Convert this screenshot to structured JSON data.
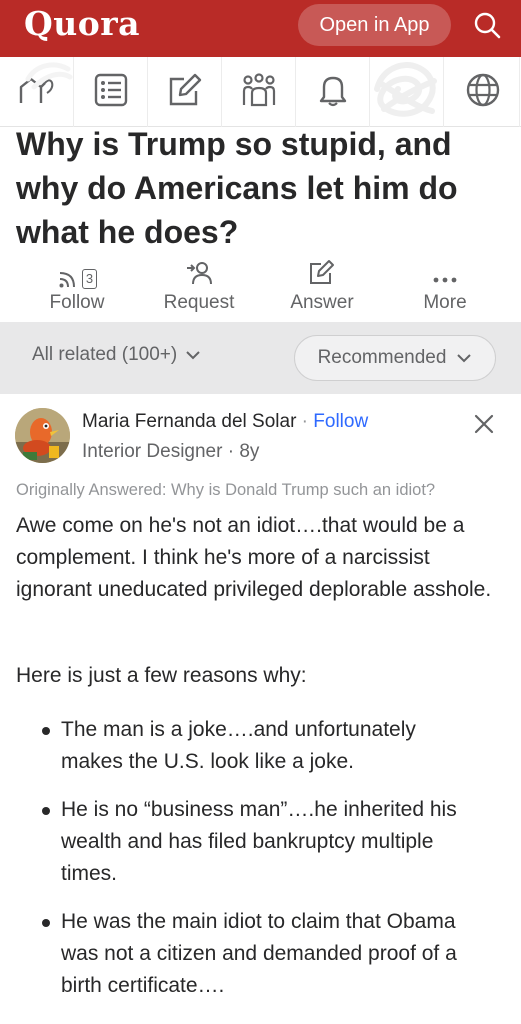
{
  "header": {
    "logo": "Quora",
    "open_app_label": "Open in App",
    "search_icon": "search-icon",
    "background": "#b92b27"
  },
  "nav": {
    "items": [
      {
        "icon": "home-icon"
      },
      {
        "icon": "following-icon"
      },
      {
        "icon": "answer-icon"
      },
      {
        "icon": "spaces-icon"
      },
      {
        "icon": "notifications-icon"
      },
      {
        "icon": "profile-icon"
      },
      {
        "icon": "language-icon"
      }
    ]
  },
  "question": {
    "title": "Why is Trump so stupid, and why do Americans let him do what he does?"
  },
  "actions": {
    "follow_count": "3",
    "follow_label": "Follow",
    "request_label": "Request",
    "answer_label": "Answer",
    "more_label": "More"
  },
  "filters": {
    "related_label": "All related (100+)",
    "sort_label": "Recommended"
  },
  "answer": {
    "author": "Maria Fernanda del Solar",
    "separator": "·",
    "follow_label": "Follow",
    "credential": "Interior Designer · 8y",
    "originally_answered": "Originally Answered: Why is Donald Trump such an idiot?",
    "paragraph1": "Awe come on he's not an idiot….that would be a complement. I think he's more of a narcissist ignorant uneducated privileged deplorable asshole.",
    "paragraph2": "Here is just a few reasons why:",
    "bullets": [
      "The man is a joke….and unfortunately makes the U.S. look like a joke.",
      "He is no “business man”….he inherited his wealth and has filed bankruptcy multiple times.",
      "He was the main idiot to claim that Obama was not a citizen and demanded proof of a birth certificate…."
    ]
  },
  "colors": {
    "link": "#2e69ff",
    "text": "#282829",
    "muted": "#636466"
  }
}
